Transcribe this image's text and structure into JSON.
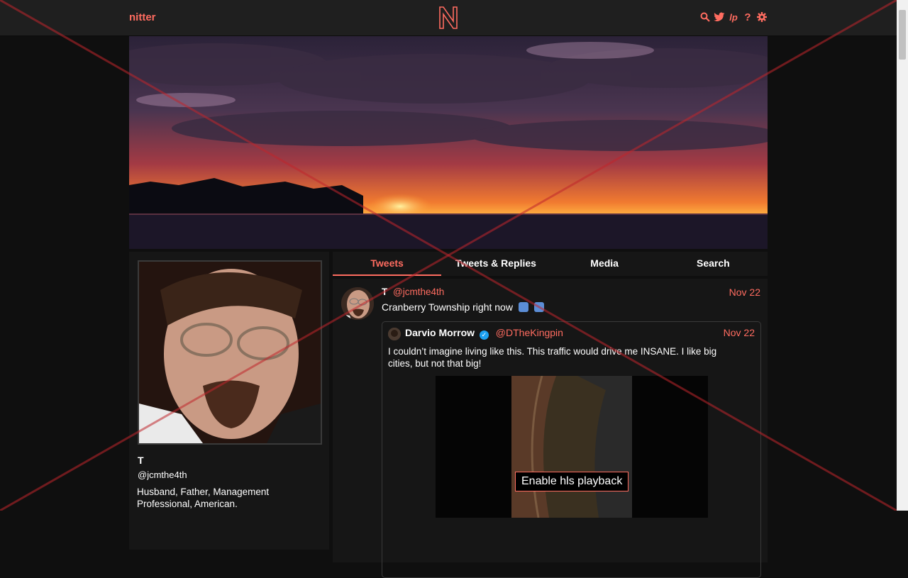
{
  "navbar": {
    "brand": "nitter",
    "logo_letter": "N",
    "icons": [
      "search-icon",
      "twitter-bird-icon",
      "liberapay-icon",
      "help-icon",
      "gear-icon"
    ],
    "help_glyph": "?",
    "liberapay_glyph": "lp"
  },
  "colors": {
    "accent": "#ff6c60",
    "background": "#0f0f0f",
    "navbar": "#1f1f1f",
    "panel": "#161616",
    "verified": "#1da1f2"
  },
  "profile": {
    "fullname": "T",
    "username": "@jcmthe4th",
    "bio": "Husband, Father, Management Professional, American."
  },
  "tabs": [
    {
      "label": "Tweets",
      "active": true
    },
    {
      "label": "Tweets & Replies",
      "active": false
    },
    {
      "label": "Media",
      "active": false
    },
    {
      "label": "Search",
      "active": false
    }
  ],
  "tweet": {
    "fullname": "T",
    "username": "@jcmthe4th",
    "date": "Nov 22",
    "text": "Cranberry Township right now",
    "quote": {
      "fullname": "Darvio Morrow",
      "verified": true,
      "username": "@DTheKingpin",
      "date": "Nov 22",
      "text": "I couldn’t imagine living like this. This traffic would drive me INSANE. I like big cities, but not that big!",
      "video_button": "Enable hls playback"
    }
  }
}
